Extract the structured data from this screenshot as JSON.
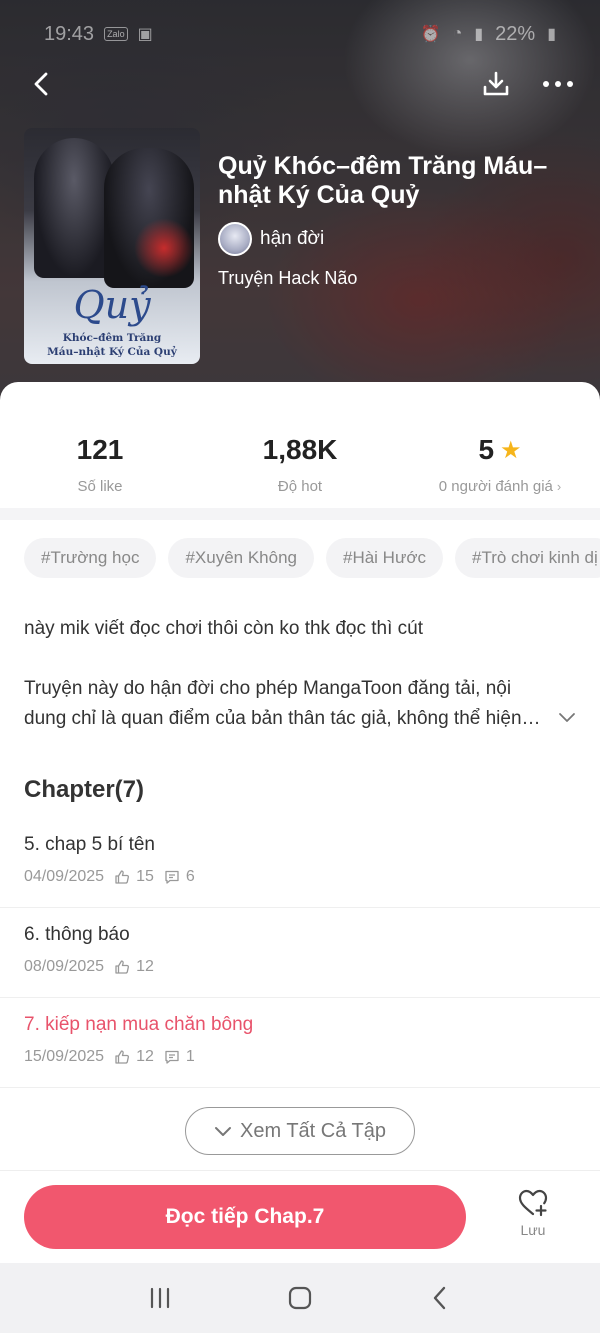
{
  "status_bar": {
    "time": "19:43",
    "zalo": "Zalo",
    "battery": "22%"
  },
  "book": {
    "title": "Quỷ Khóc–đêm Trăng Máu–nhật Ký Của Quỷ",
    "author": "hận đời",
    "category": "Truyện Hack Não",
    "cover_title": "Quỷ",
    "cover_subtitle_line1": "Khóc–đêm Trăng",
    "cover_subtitle_line2": "Máu–nhật Ký Của Quỷ"
  },
  "stats": {
    "likes_value": "121",
    "likes_label": "Số like",
    "hot_value": "1,88K",
    "hot_label": "Độ hot",
    "rating_value": "5",
    "rating_label": "0 người đánh giá"
  },
  "tags": [
    "#Trường học",
    "#Xuyên Không",
    "#Hài Hước",
    "#Trò chơi kinh dị"
  ],
  "description": {
    "line1": "này mik viết đọc chơi thôi còn ko thk đọc thì cút",
    "line2": "Truyện này do hận đời  cho phép MangaToon đăng tải, nội dung chỉ là quan điểm của bản thân tác giả, không thể hiện…"
  },
  "chapters": {
    "heading": "Chapter(7)",
    "items": [
      {
        "title": "5. chap 5 bí tên",
        "date": "04/09/2025",
        "likes": "15",
        "comments": "6"
      },
      {
        "title": "6. thông báo",
        "date": "08/09/2025",
        "likes": "12",
        "comments": ""
      },
      {
        "title": "7. kiếp nạn mua chăn bông",
        "date": "15/09/2025",
        "likes": "12",
        "comments": "1"
      }
    ],
    "see_all": "Xem Tất Cả Tập"
  },
  "actions": {
    "read_continue": "Đọc tiếp Chap.7",
    "save_label": "Lưu"
  },
  "colors": {
    "accent": "#f1576e",
    "active_chapter": "#e8536b",
    "star": "#f6b51b"
  }
}
